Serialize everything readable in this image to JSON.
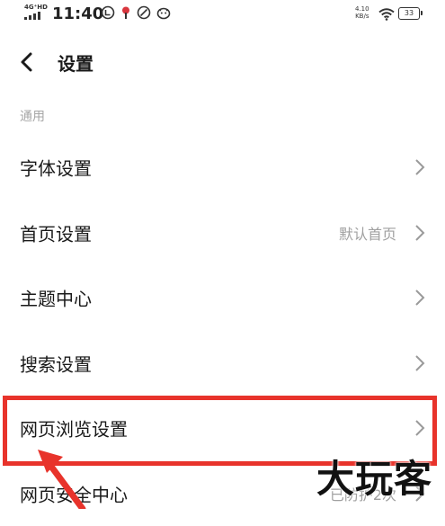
{
  "status_bar": {
    "network": "4G⁺HD",
    "time": "11:40",
    "speed_top": "4.10",
    "speed_bottom": "KB/s",
    "battery": "33"
  },
  "header": {
    "title": "设置"
  },
  "section": {
    "label": "通用"
  },
  "items": [
    {
      "label": "字体设置",
      "value": ""
    },
    {
      "label": "首页设置",
      "value": "默认首页"
    },
    {
      "label": "主题中心",
      "value": ""
    },
    {
      "label": "搜索设置",
      "value": ""
    },
    {
      "label": "网页浏览设置",
      "value": ""
    },
    {
      "label": "网页安全中心",
      "value": "已防护2次"
    }
  ],
  "watermark": "大玩客",
  "colors": {
    "highlight": "#e8332b",
    "secondary_text": "#a0a0a0",
    "section_text": "#a6a6a6"
  }
}
